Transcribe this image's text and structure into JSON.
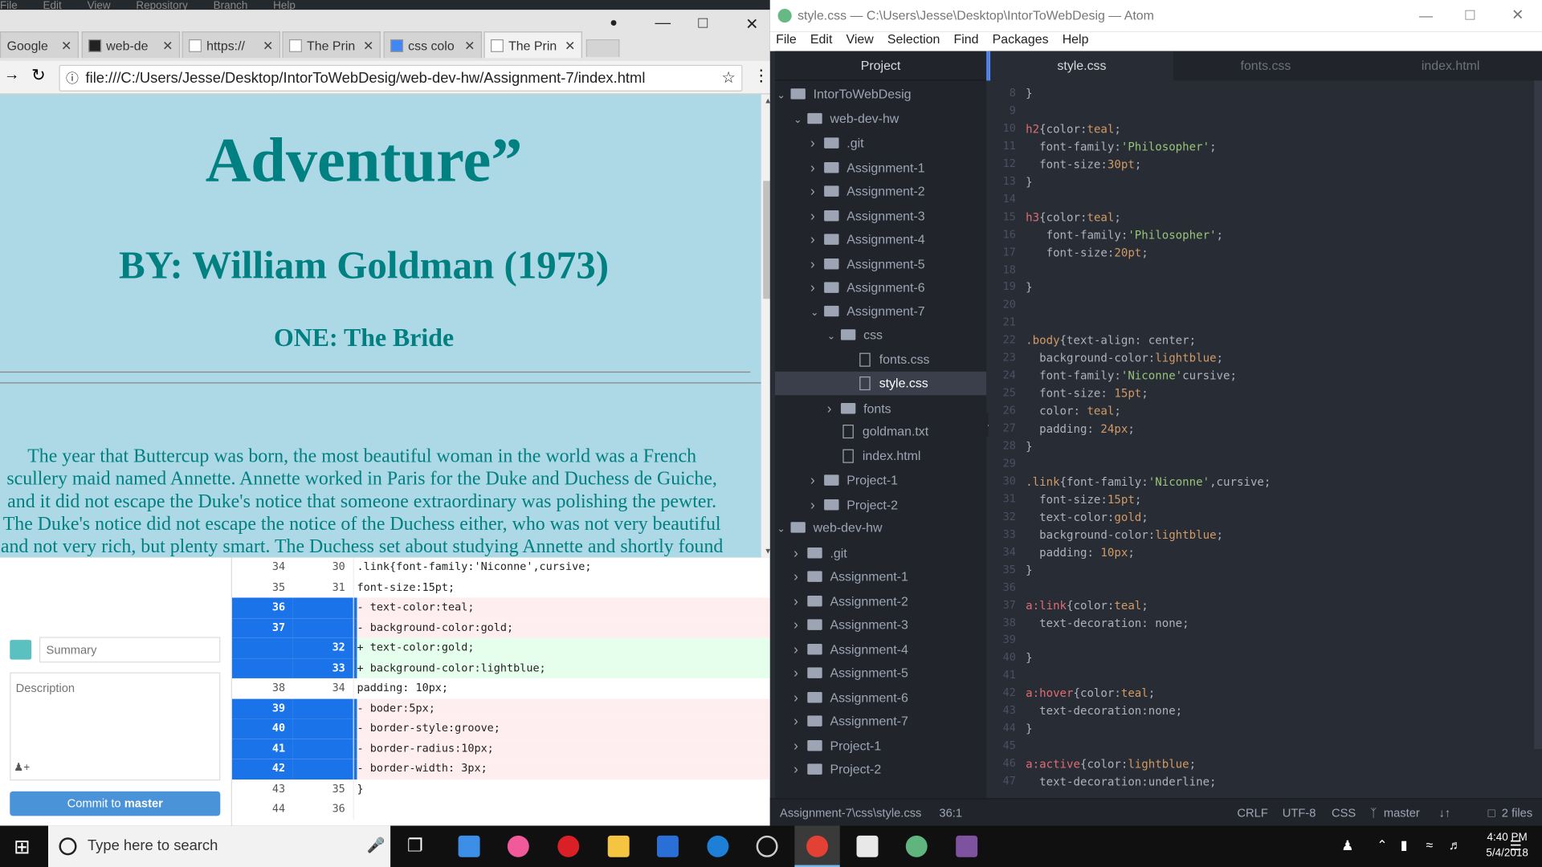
{
  "ghd": {
    "menu": [
      "File",
      "Edit",
      "View",
      "Repository",
      "Branch",
      "Help"
    ],
    "summary_placeholder": "Summary",
    "description_placeholder": "Description",
    "commit_prefix": "Commit to ",
    "commit_branch": "master",
    "diff_rows": [
      {
        "o": "34",
        "n": "30",
        "t": "ctx",
        "code": ".link{font-family:'Niconne',cursive;"
      },
      {
        "o": "35",
        "n": "31",
        "t": "ctx",
        "code": "  font-size:15pt;"
      },
      {
        "o": "36",
        "n": "",
        "t": "del",
        "code": "-  text-color:teal;"
      },
      {
        "o": "37",
        "n": "",
        "t": "del",
        "code": "-  background-color:gold;"
      },
      {
        "o": "",
        "n": "32",
        "t": "add",
        "code": "+  text-color:gold;"
      },
      {
        "o": "",
        "n": "33",
        "t": "add",
        "code": "+  background-color:lightblue;"
      },
      {
        "o": "38",
        "n": "34",
        "t": "ctx",
        "code": "  padding: 10px;"
      },
      {
        "o": "39",
        "n": "",
        "t": "del",
        "code": "-  boder:5px;"
      },
      {
        "o": "40",
        "n": "",
        "t": "del",
        "code": "-  border-style:groove;"
      },
      {
        "o": "41",
        "n": "",
        "t": "del",
        "code": "-  border-radius:10px;"
      },
      {
        "o": "42",
        "n": "",
        "t": "del",
        "code": "-  border-width: 3px;"
      },
      {
        "o": "43",
        "n": "35",
        "t": "ctx",
        "code": "}"
      },
      {
        "o": "44",
        "n": "36",
        "t": "ctx",
        "code": ""
      }
    ]
  },
  "chrome": {
    "tabs": [
      "Google",
      "web-de",
      "https://",
      "The Prin",
      "css colo",
      "The Prin"
    ],
    "url": "file:///C:/Users/Jesse/Desktop/IntorToWebDesig/web-dev-hw/Assignment-7/index.html",
    "page": {
      "title_line2": "Adventure”",
      "byline": "BY: William Goldman (1973)",
      "chapter": "ONE: The Bride",
      "paragraph": "The year that Buttercup was born, the most beautiful woman in the world was a French scullery maid named Annette. Annette worked in Paris for the Duke and Duchess de Guiche, and it did not escape the Duke's notice that someone extraordinary was polishing the pewter. The Duke's notice did not escape the notice of the Duchess either, who was not very beautiful and not very rich, but plenty smart. The Duchess set about studying Annette and shortly found her adversary's tragic flaw"
    }
  },
  "atom": {
    "title": "style.css — C:\\Users\\Jesse\\Desktop\\IntorToWebDesig — Atom",
    "menu": [
      "File",
      "Edit",
      "View",
      "Selection",
      "Find",
      "Packages",
      "Help"
    ],
    "project_label": "Project",
    "tree": [
      {
        "d": 0,
        "k": "folder",
        "o": true,
        "n": "IntorToWebDesig"
      },
      {
        "d": 1,
        "k": "folder",
        "o": true,
        "n": "web-dev-hw"
      },
      {
        "d": 2,
        "k": "folder",
        "o": false,
        "n": ".git"
      },
      {
        "d": 2,
        "k": "folder",
        "o": false,
        "n": "Assignment-1"
      },
      {
        "d": 2,
        "k": "folder",
        "o": false,
        "n": "Assignment-2"
      },
      {
        "d": 2,
        "k": "folder",
        "o": false,
        "n": "Assignment-3"
      },
      {
        "d": 2,
        "k": "folder",
        "o": false,
        "n": "Assignment-4"
      },
      {
        "d": 2,
        "k": "folder",
        "o": false,
        "n": "Assignment-5"
      },
      {
        "d": 2,
        "k": "folder",
        "o": false,
        "n": "Assignment-6"
      },
      {
        "d": 2,
        "k": "folder",
        "o": true,
        "n": "Assignment-7"
      },
      {
        "d": 3,
        "k": "folder",
        "o": true,
        "n": "css"
      },
      {
        "d": 4,
        "k": "file",
        "n": "fonts.css"
      },
      {
        "d": 4,
        "k": "file",
        "n": "style.css",
        "sel": true
      },
      {
        "d": 3,
        "k": "folder",
        "o": false,
        "n": "fonts"
      },
      {
        "d": 3,
        "k": "file",
        "n": "goldman.txt"
      },
      {
        "d": 3,
        "k": "file",
        "n": "index.html"
      },
      {
        "d": 2,
        "k": "folder",
        "o": false,
        "n": "Project-1"
      },
      {
        "d": 2,
        "k": "folder",
        "o": false,
        "n": "Project-2"
      },
      {
        "d": 0,
        "k": "folder",
        "o": true,
        "n": "web-dev-hw"
      },
      {
        "d": 1,
        "k": "folder",
        "o": false,
        "n": ".git"
      },
      {
        "d": 1,
        "k": "folder",
        "o": false,
        "n": "Assignment-1"
      },
      {
        "d": 1,
        "k": "folder",
        "o": false,
        "n": "Assignment-2"
      },
      {
        "d": 1,
        "k": "folder",
        "o": false,
        "n": "Assignment-3"
      },
      {
        "d": 1,
        "k": "folder",
        "o": false,
        "n": "Assignment-4"
      },
      {
        "d": 1,
        "k": "folder",
        "o": false,
        "n": "Assignment-5"
      },
      {
        "d": 1,
        "k": "folder",
        "o": false,
        "n": "Assignment-6"
      },
      {
        "d": 1,
        "k": "folder",
        "o": false,
        "n": "Assignment-7"
      },
      {
        "d": 1,
        "k": "folder",
        "o": false,
        "n": "Project-1"
      },
      {
        "d": 1,
        "k": "folder",
        "o": false,
        "n": "Project-2"
      }
    ],
    "tabs": [
      "style.css",
      "fonts.css",
      "index.html"
    ],
    "code": [
      {
        "n": "8",
        "s": [
          [
            "}",
            ""
          ]
        ]
      },
      {
        "n": "9",
        "s": []
      },
      {
        "n": "10",
        "s": [
          [
            "h2",
            "sel-c"
          ],
          [
            "{color:",
            ""
          ],
          [
            "teal",
            "val"
          ],
          [
            ";",
            ""
          ]
        ]
      },
      {
        "n": "11",
        "s": [
          [
            "  font-family:",
            ""
          ],
          [
            "'Philosopher'",
            "str"
          ],
          [
            ";",
            ""
          ]
        ]
      },
      {
        "n": "12",
        "s": [
          [
            "  font-size:",
            ""
          ],
          [
            "30pt",
            "val"
          ],
          [
            ";",
            ""
          ]
        ]
      },
      {
        "n": "13",
        "s": [
          [
            "}",
            ""
          ]
        ]
      },
      {
        "n": "14",
        "s": []
      },
      {
        "n": "15",
        "s": [
          [
            "h3",
            "sel-c"
          ],
          [
            "{color:",
            ""
          ],
          [
            "teal",
            "val"
          ],
          [
            ";",
            ""
          ]
        ]
      },
      {
        "n": "16",
        "s": [
          [
            "   font-family:",
            ""
          ],
          [
            "'Philosopher'",
            "str"
          ],
          [
            ";",
            ""
          ]
        ]
      },
      {
        "n": "17",
        "s": [
          [
            "   font-size:",
            ""
          ],
          [
            "20pt",
            "val"
          ],
          [
            ";",
            ""
          ]
        ]
      },
      {
        "n": "18",
        "s": []
      },
      {
        "n": "19",
        "s": [
          [
            "}",
            ""
          ]
        ]
      },
      {
        "n": "20",
        "s": []
      },
      {
        "n": "21",
        "s": []
      },
      {
        "n": "22",
        "s": [
          [
            ".body",
            "val"
          ],
          [
            "{text-align: center;",
            ""
          ]
        ]
      },
      {
        "n": "23",
        "s": [
          [
            "  background-color:",
            ""
          ],
          [
            "lightblue",
            "val"
          ],
          [
            ";",
            ""
          ]
        ]
      },
      {
        "n": "24",
        "s": [
          [
            "  font-family:",
            ""
          ],
          [
            "'Niconne'",
            "str"
          ],
          [
            "cursive;",
            ""
          ]
        ]
      },
      {
        "n": "25",
        "s": [
          [
            "  font-size: ",
            ""
          ],
          [
            "15pt",
            "val"
          ],
          [
            ";",
            ""
          ]
        ]
      },
      {
        "n": "26",
        "s": [
          [
            "  color: ",
            ""
          ],
          [
            "teal",
            "val"
          ],
          [
            ";",
            ""
          ]
        ]
      },
      {
        "n": "27",
        "s": [
          [
            "  padding: ",
            ""
          ],
          [
            "24px",
            "val"
          ],
          [
            ";",
            ""
          ]
        ]
      },
      {
        "n": "28",
        "s": [
          [
            "}",
            ""
          ]
        ]
      },
      {
        "n": "29",
        "s": []
      },
      {
        "n": "30",
        "s": [
          [
            ".link",
            "val"
          ],
          [
            "{font-family:",
            ""
          ],
          [
            "'Niconne'",
            "str"
          ],
          [
            ",cursive;",
            ""
          ]
        ]
      },
      {
        "n": "31",
        "s": [
          [
            "  font-size:",
            ""
          ],
          [
            "15pt",
            "val"
          ],
          [
            ";",
            ""
          ]
        ]
      },
      {
        "n": "32",
        "s": [
          [
            "  text-color:",
            ""
          ],
          [
            "gold",
            "val"
          ],
          [
            ";",
            ""
          ]
        ]
      },
      {
        "n": "33",
        "s": [
          [
            "  background-color:",
            ""
          ],
          [
            "lightblue",
            "val"
          ],
          [
            ";",
            ""
          ]
        ]
      },
      {
        "n": "34",
        "s": [
          [
            "  padding: ",
            ""
          ],
          [
            "10px",
            "val"
          ],
          [
            ";",
            ""
          ]
        ]
      },
      {
        "n": "35",
        "s": [
          [
            "}",
            ""
          ]
        ]
      },
      {
        "n": "36",
        "s": []
      },
      {
        "n": "37",
        "s": [
          [
            "a:link",
            "sel-c"
          ],
          [
            "{color:",
            ""
          ],
          [
            "teal",
            "val"
          ],
          [
            ";",
            ""
          ]
        ]
      },
      {
        "n": "38",
        "s": [
          [
            "  text-decoration: none;",
            ""
          ]
        ]
      },
      {
        "n": "39",
        "s": []
      },
      {
        "n": "40",
        "s": [
          [
            "}",
            ""
          ]
        ]
      },
      {
        "n": "41",
        "s": []
      },
      {
        "n": "42",
        "s": [
          [
            "a:hover",
            "sel-c"
          ],
          [
            "{color:",
            ""
          ],
          [
            "teal",
            "val"
          ],
          [
            ";",
            ""
          ]
        ]
      },
      {
        "n": "43",
        "s": [
          [
            "  text-decoration:none;",
            ""
          ]
        ]
      },
      {
        "n": "44",
        "s": [
          [
            "}",
            ""
          ]
        ]
      },
      {
        "n": "45",
        "s": []
      },
      {
        "n": "46",
        "s": [
          [
            "a:active",
            "sel-c"
          ],
          [
            "{color:",
            ""
          ],
          [
            "lightblue",
            "val"
          ],
          [
            ";",
            ""
          ]
        ]
      },
      {
        "n": "47",
        "s": [
          [
            "  text-decoration:underline;",
            ""
          ]
        ]
      }
    ],
    "status": {
      "path": "Assignment-7\\css\\style.css",
      "pos": "36:1",
      "eol": "CRLF",
      "enc": "UTF-8",
      "lang": "CSS",
      "branch": "master",
      "files": "2 files"
    }
  },
  "taskbar": {
    "search_placeholder": "Type here to search",
    "time": "4:40 PM",
    "date": "5/4/2018"
  },
  "colors": {
    "teal": "#008080",
    "lightblue": "#add8e6"
  }
}
